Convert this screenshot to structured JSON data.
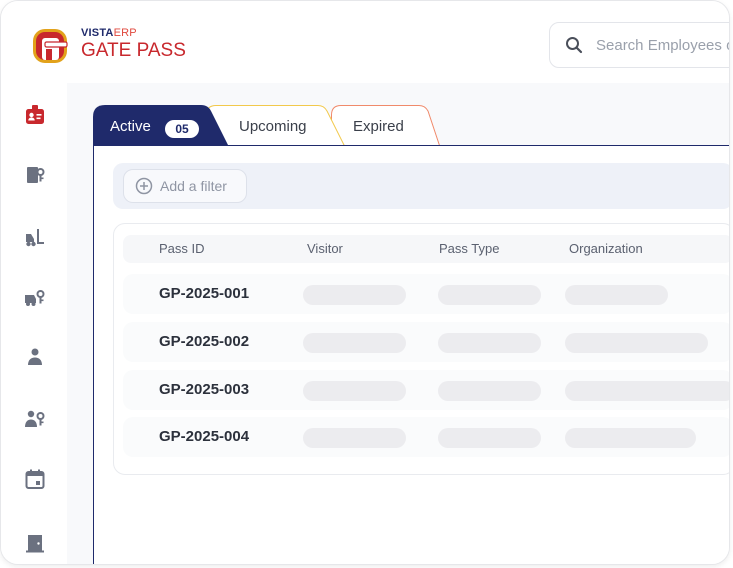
{
  "brand": {
    "vista": "VISTA",
    "erp": "ERP",
    "product": "GATE PASS"
  },
  "search": {
    "placeholder": "Search Employees or Pass ID"
  },
  "sidebar": {
    "items": [
      {
        "icon": "id-badge-icon",
        "active": true
      },
      {
        "icon": "door-pass-icon"
      },
      {
        "icon": "forklift-icon"
      },
      {
        "icon": "vehicle-pass-icon"
      },
      {
        "icon": "visitor-icon"
      },
      {
        "icon": "visitor-pass-icon"
      },
      {
        "icon": "calendar-icon"
      },
      {
        "icon": "exit-door-icon"
      }
    ]
  },
  "tabs": [
    {
      "label": "Active",
      "count": "05",
      "active": true
    },
    {
      "label": "Upcoming",
      "color": "#f2c94c"
    },
    {
      "label": "Expired",
      "color": "#f08a6b"
    }
  ],
  "filter": {
    "add_label": "Add a filter"
  },
  "table": {
    "columns": [
      "Pass ID",
      "Visitor",
      "Pass Type",
      "Organization"
    ],
    "rows": [
      {
        "pass_id": "GP-2025-001"
      },
      {
        "pass_id": "GP-2025-002"
      },
      {
        "pass_id": "GP-2025-003"
      },
      {
        "pass_id": "GP-2025-004"
      }
    ]
  },
  "colors": {
    "navy": "#1f2a6b",
    "brand_red": "#c8282d",
    "upcoming_yellow": "#f2c94c",
    "expired_orange": "#f08a6b"
  }
}
